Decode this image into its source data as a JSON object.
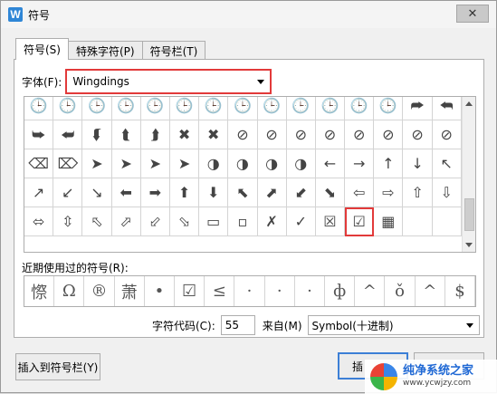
{
  "window": {
    "title": "符号",
    "app_icon": "W"
  },
  "tabs": [
    {
      "label": "符号(S)",
      "active": true
    },
    {
      "label": "特殊字符(P)",
      "active": false
    },
    {
      "label": "符号栏(T)",
      "active": false
    }
  ],
  "font": {
    "label": "字体(F):",
    "value": "Wingdings"
  },
  "symbols": [
    "🕒",
    "🕒",
    "🕒",
    "🕒",
    "🕒",
    "🕒",
    "🕒",
    "🕒",
    "🕒",
    "🕒",
    "🕒",
    "🕒",
    "🕒",
    "⮫",
    "⮪",
    "⮩",
    "⮨",
    "⮮",
    "⮬",
    "⮭",
    "✖",
    "✖",
    "⊘",
    "⊘",
    "⊘",
    "⊘",
    "⊘",
    "⊘",
    "⊘",
    "⊘",
    "⌫",
    "⌦",
    "➤",
    "➤",
    "➤",
    "➤",
    "◑",
    "◑",
    "◑",
    "◑",
    "←",
    "→",
    "↑",
    "↓",
    "↖",
    "↗",
    "↙",
    "↘",
    "⬅",
    "➡",
    "⬆",
    "⬇",
    "⬉",
    "⬈",
    "⬋",
    "⬊",
    "⇦",
    "⇨",
    "⇧",
    "⇩",
    "⬄",
    "⇳",
    "⬁",
    "⬀",
    "⬃",
    "⬂",
    "▭",
    "▫",
    "✗",
    "✓",
    "☒",
    "☑",
    "▦"
  ],
  "selected_symbol": "☑",
  "recent": {
    "label": "近期使用过的符号(R):",
    "items": [
      "憏",
      "Ω",
      "®",
      "萧",
      "•",
      "☑",
      "≤",
      "·",
      "·",
      "·",
      "ф",
      "^",
      "ǒ",
      "^",
      "$"
    ]
  },
  "char_code": {
    "label": "字符代码(C):",
    "value": "55"
  },
  "from": {
    "label": "来自(M)",
    "value": "Symbol(十进制)"
  },
  "buttons": {
    "insert_to_bar": "插入到符号栏(Y)",
    "insert": "插",
    "cancel": ""
  },
  "watermark": {
    "title": "纯净系统之家",
    "url": "www.ycwjzy.com"
  },
  "colors": {
    "highlight": "#e23a3a",
    "accent": "#3c7fd6"
  }
}
